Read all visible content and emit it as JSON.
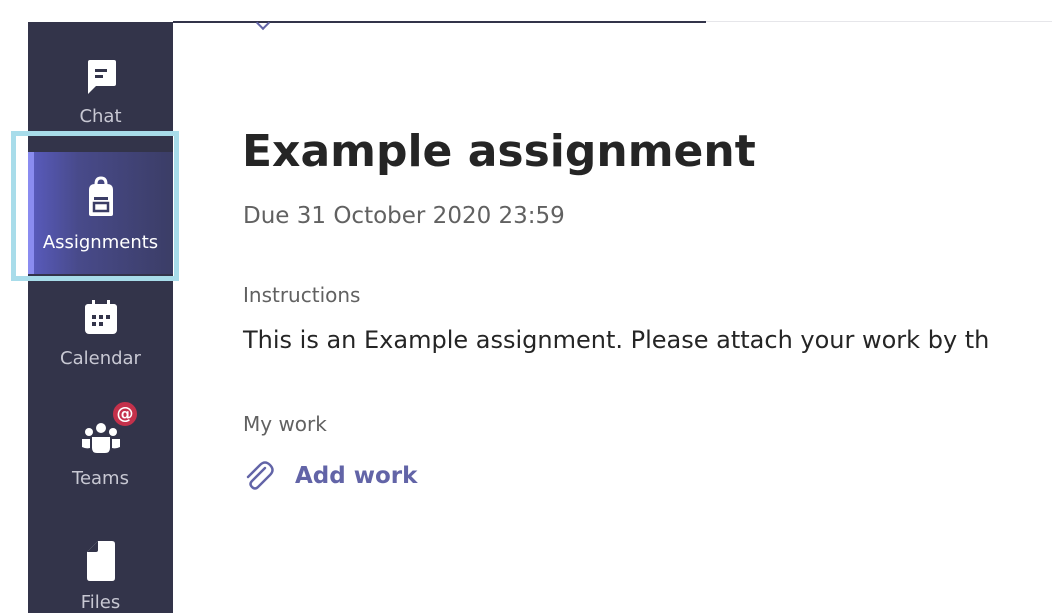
{
  "rail": {
    "items": [
      {
        "label": "Chat",
        "icon": "chat-icon"
      },
      {
        "label": "Assignments",
        "icon": "assignments-backpack-icon",
        "selected": true
      },
      {
        "label": "Calendar",
        "icon": "calendar-icon"
      },
      {
        "label": "Teams",
        "icon": "teams-icon",
        "badge": "@"
      },
      {
        "label": "Files",
        "icon": "file-icon"
      }
    ]
  },
  "assignment": {
    "title": "Example assignment",
    "due": "Due 31 October 2020 23:59",
    "instructions_label": "Instructions",
    "instructions_text": "This is an Example assignment. Please attach your work by th",
    "my_work_label": "My work",
    "add_work_label": "Add work"
  },
  "colors": {
    "rail_background": "#33344a",
    "accent": "#6264a7",
    "highlight_frame": "#a8dcea",
    "badge": "#c4314b"
  }
}
